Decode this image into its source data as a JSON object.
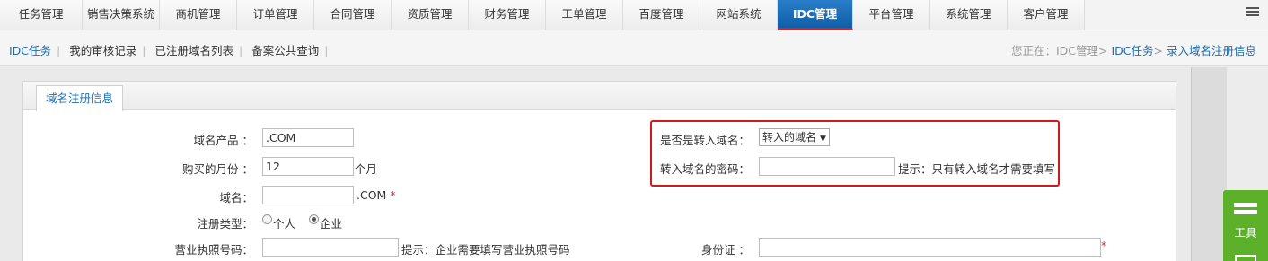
{
  "topnav": {
    "tabs": [
      {
        "label": "任务管理"
      },
      {
        "label": "销售决策系统"
      },
      {
        "label": "商机管理"
      },
      {
        "label": "订单管理"
      },
      {
        "label": "合同管理"
      },
      {
        "label": "资质管理"
      },
      {
        "label": "财务管理"
      },
      {
        "label": "工单管理"
      },
      {
        "label": "百度管理"
      },
      {
        "label": "网站系统"
      },
      {
        "label": "IDC管理"
      },
      {
        "label": "平台管理"
      },
      {
        "label": "系统管理"
      },
      {
        "label": "客户管理"
      }
    ],
    "active_tab": "IDC管理"
  },
  "subnav": {
    "links": [
      "IDC任务",
      "我的审核记录",
      "已注册域名列表",
      "备案公共查询"
    ],
    "breadcrumb": {
      "prefix": "您正在：IDC管理>",
      "item1": "IDC任务",
      "sep": ">",
      "item2": "录入域名注册信息"
    }
  },
  "panel": {
    "tab_label": "域名注册信息",
    "form": {
      "product_label": "域名产品 ：",
      "product_value": ".COM",
      "months_label": "购买的月份 ：",
      "months_value": "12",
      "months_unit": "个月",
      "domain_label": "域名：",
      "domain_value": "",
      "domain_suffix": ".COM",
      "required_mark": "*",
      "reg_type_label": "注册类型：",
      "reg_type_options": [
        "个人",
        "企业"
      ],
      "reg_type_selected": "企业",
      "license_label": "营业执照号码：",
      "license_value": "",
      "license_hint": "提示：企业需要填写营业执照号码",
      "id_label": "身份证 ：",
      "id_value": "",
      "transfer_label": "是否是转入域名：",
      "transfer_value": "转入的域名",
      "transfer_pwd_label": "转入域名的密码：",
      "transfer_pwd_value": "",
      "transfer_pwd_hint": "提示：只有转入域名才需要填写"
    }
  },
  "toolbox": {
    "label": "工具",
    "icon": "toolbox-icon",
    "mail_icon": "mail-icon"
  },
  "colors": {
    "accent": "#1b6db8",
    "active_tab": "#0f5ea8",
    "highlight_box": "#d0191b",
    "tool_green": "#5cb02a"
  }
}
